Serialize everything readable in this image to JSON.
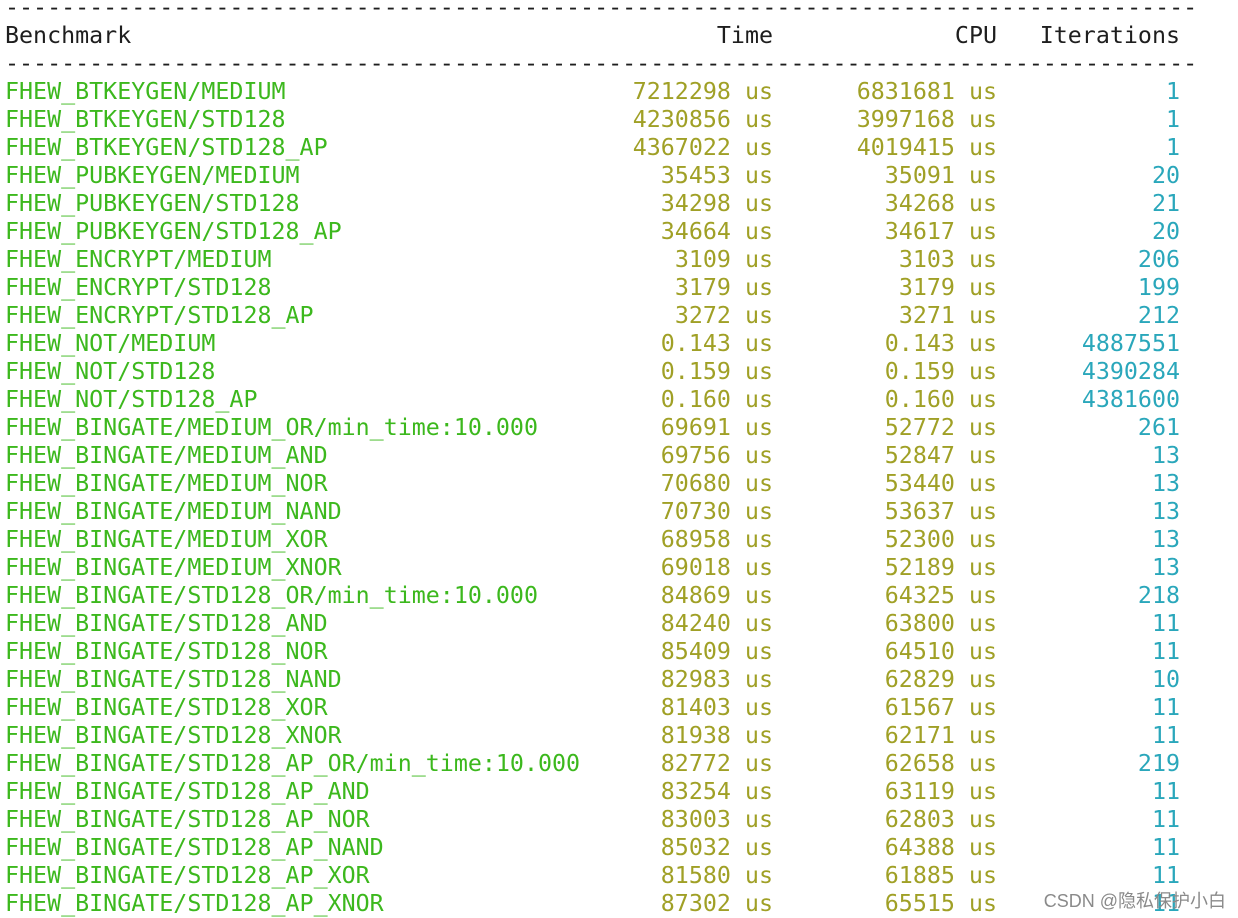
{
  "colors": {
    "name": "#3cb81d",
    "time": "#a0a026",
    "iter": "#2aa7bb",
    "text": "#1e1e1e"
  },
  "separator": "-------------------------------------------------------------------------------------",
  "header": {
    "benchmark": "Benchmark",
    "time": "Time",
    "cpu": "CPU",
    "iterations": "Iterations"
  },
  "rows": [
    {
      "name": "FHEW_BTKEYGEN/MEDIUM",
      "time": "7212298 us",
      "cpu": "6831681 us",
      "iterations": "1"
    },
    {
      "name": "FHEW_BTKEYGEN/STD128",
      "time": "4230856 us",
      "cpu": "3997168 us",
      "iterations": "1"
    },
    {
      "name": "FHEW_BTKEYGEN/STD128_AP",
      "time": "4367022 us",
      "cpu": "4019415 us",
      "iterations": "1"
    },
    {
      "name": "FHEW_PUBKEYGEN/MEDIUM",
      "time": "35453 us",
      "cpu": "35091 us",
      "iterations": "20"
    },
    {
      "name": "FHEW_PUBKEYGEN/STD128",
      "time": "34298 us",
      "cpu": "34268 us",
      "iterations": "21"
    },
    {
      "name": "FHEW_PUBKEYGEN/STD128_AP",
      "time": "34664 us",
      "cpu": "34617 us",
      "iterations": "20"
    },
    {
      "name": "FHEW_ENCRYPT/MEDIUM",
      "time": "3109 us",
      "cpu": "3103 us",
      "iterations": "206"
    },
    {
      "name": "FHEW_ENCRYPT/STD128",
      "time": "3179 us",
      "cpu": "3179 us",
      "iterations": "199"
    },
    {
      "name": "FHEW_ENCRYPT/STD128_AP",
      "time": "3272 us",
      "cpu": "3271 us",
      "iterations": "212"
    },
    {
      "name": "FHEW_NOT/MEDIUM",
      "time": "0.143 us",
      "cpu": "0.143 us",
      "iterations": "4887551"
    },
    {
      "name": "FHEW_NOT/STD128",
      "time": "0.159 us",
      "cpu": "0.159 us",
      "iterations": "4390284"
    },
    {
      "name": "FHEW_NOT/STD128_AP",
      "time": "0.160 us",
      "cpu": "0.160 us",
      "iterations": "4381600"
    },
    {
      "name": "FHEW_BINGATE/MEDIUM_OR/min_time:10.000",
      "time": "69691 us",
      "cpu": "52772 us",
      "iterations": "261"
    },
    {
      "name": "FHEW_BINGATE/MEDIUM_AND",
      "time": "69756 us",
      "cpu": "52847 us",
      "iterations": "13"
    },
    {
      "name": "FHEW_BINGATE/MEDIUM_NOR",
      "time": "70680 us",
      "cpu": "53440 us",
      "iterations": "13"
    },
    {
      "name": "FHEW_BINGATE/MEDIUM_NAND",
      "time": "70730 us",
      "cpu": "53637 us",
      "iterations": "13"
    },
    {
      "name": "FHEW_BINGATE/MEDIUM_XOR",
      "time": "68958 us",
      "cpu": "52300 us",
      "iterations": "13"
    },
    {
      "name": "FHEW_BINGATE/MEDIUM_XNOR",
      "time": "69018 us",
      "cpu": "52189 us",
      "iterations": "13"
    },
    {
      "name": "FHEW_BINGATE/STD128_OR/min_time:10.000",
      "time": "84869 us",
      "cpu": "64325 us",
      "iterations": "218"
    },
    {
      "name": "FHEW_BINGATE/STD128_AND",
      "time": "84240 us",
      "cpu": "63800 us",
      "iterations": "11"
    },
    {
      "name": "FHEW_BINGATE/STD128_NOR",
      "time": "85409 us",
      "cpu": "64510 us",
      "iterations": "11"
    },
    {
      "name": "FHEW_BINGATE/STD128_NAND",
      "time": "82983 us",
      "cpu": "62829 us",
      "iterations": "10"
    },
    {
      "name": "FHEW_BINGATE/STD128_XOR",
      "time": "81403 us",
      "cpu": "61567 us",
      "iterations": "11"
    },
    {
      "name": "FHEW_BINGATE/STD128_XNOR",
      "time": "81938 us",
      "cpu": "62171 us",
      "iterations": "11"
    },
    {
      "name": "FHEW_BINGATE/STD128_AP_OR/min_time:10.000",
      "time": "82772 us",
      "cpu": "62658 us",
      "iterations": "219"
    },
    {
      "name": "FHEW_BINGATE/STD128_AP_AND",
      "time": "83254 us",
      "cpu": "63119 us",
      "iterations": "11"
    },
    {
      "name": "FHEW_BINGATE/STD128_AP_NOR",
      "time": "83003 us",
      "cpu": "62803 us",
      "iterations": "11"
    },
    {
      "name": "FHEW_BINGATE/STD128_AP_NAND",
      "time": "85032 us",
      "cpu": "64388 us",
      "iterations": "11"
    },
    {
      "name": "FHEW_BINGATE/STD128_AP_XOR",
      "time": "81580 us",
      "cpu": "61885 us",
      "iterations": "11"
    },
    {
      "name": "FHEW_BINGATE/STD128_AP_XNOR",
      "time": "87302 us",
      "cpu": "65515 us",
      "iterations": "11"
    }
  ],
  "watermark": "CSDN @隐私保护小白"
}
